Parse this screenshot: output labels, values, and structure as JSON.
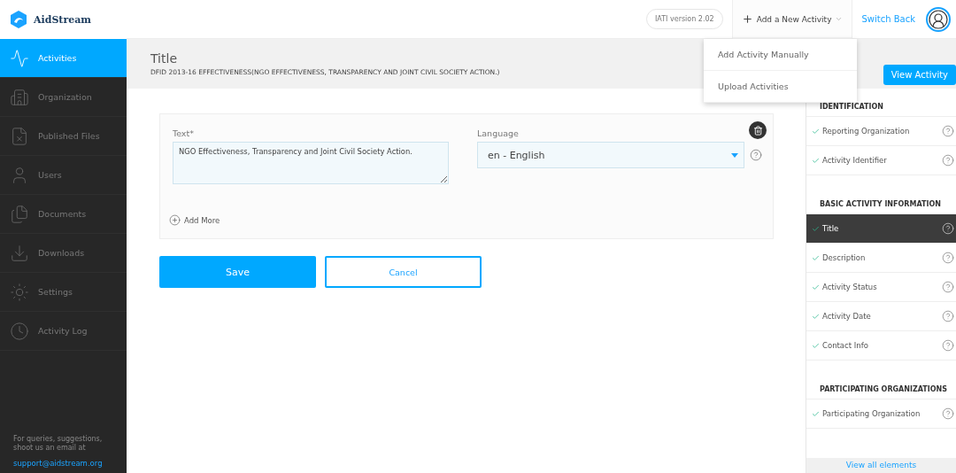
{
  "header": {
    "logo": "AidStream",
    "version": "IATI version 2.02",
    "add_activity": {
      "label": "Add a New Activity",
      "expanded": true,
      "menu": [
        "Add Activity Manually",
        "Upload Activities"
      ]
    },
    "switch_back": "Switch Back"
  },
  "sidebar": {
    "items": [
      {
        "label": "Activities",
        "selected": true
      },
      {
        "label": "Organization",
        "selected": false
      },
      {
        "label": "Published Files",
        "selected": false
      },
      {
        "label": "Users",
        "selected": false
      },
      {
        "label": "Documents",
        "selected": false
      },
      {
        "label": "Downloads",
        "selected": false
      },
      {
        "label": "Settings",
        "selected": false
      },
      {
        "label": "Activity Log",
        "selected": false
      }
    ],
    "footer": {
      "text": "For queries, suggestions, shoot us an email at",
      "email": "support@aidstream.org"
    }
  },
  "page": {
    "title": "Title",
    "subtitle": "DFID 2013-16 EFFECTIVENESS(NGO EFFECTIVENESS, TRANSPARENCY AND JOINT CIVIL SOCIETY ACTION.)",
    "view_button": "View Activity"
  },
  "form": {
    "text_label": "Text",
    "required_mark": "*",
    "text_value": "NGO Effectiveness, Transparency and Joint Civil Society Action.",
    "language_label": "Language",
    "language_value": "en - English",
    "add_more": "Add More",
    "save": "Save",
    "cancel": "Cancel"
  },
  "elements": {
    "sections": [
      {
        "heading": "IDENTIFICATION",
        "items": [
          {
            "label": "Reporting Organization",
            "checked": true,
            "selected": false
          },
          {
            "label": "Activity Identifier",
            "checked": true,
            "selected": false
          }
        ]
      },
      {
        "heading": "BASIC ACTIVITY INFORMATION",
        "items": [
          {
            "label": "Title",
            "checked": true,
            "selected": true
          },
          {
            "label": "Description",
            "checked": true,
            "selected": false
          },
          {
            "label": "Activity Status",
            "checked": true,
            "selected": false
          },
          {
            "label": "Activity Date",
            "checked": true,
            "selected": false
          },
          {
            "label": "Contact Info",
            "checked": true,
            "selected": false
          }
        ]
      },
      {
        "heading": "PARTICIPATING ORGANIZATIONS",
        "items": [
          {
            "label": "Participating Organization",
            "checked": true,
            "selected": false
          }
        ]
      }
    ],
    "view_all": "View all elements"
  }
}
